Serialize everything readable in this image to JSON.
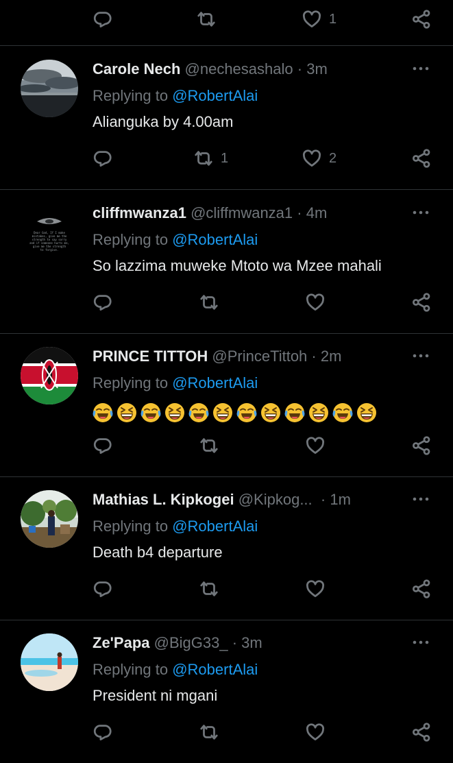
{
  "reply_prefix": "Replying to",
  "colors": {
    "background": "#000000",
    "text": "#e7e9ea",
    "muted": "#71767b",
    "link": "#1d9bf0",
    "divider": "#2f3336"
  },
  "icons": {
    "reply": "comment-icon",
    "retweet": "retweet-icon",
    "like": "heart-icon",
    "share": "share-icon",
    "more": "more-dots-icon"
  },
  "top_actions": {
    "reply_count": "",
    "retweet_count": "",
    "like_count": "1"
  },
  "tweets": [
    {
      "name": "Carole Nech",
      "handle": "@nechesashalo",
      "time": "3m",
      "replying_to": "@RobertAlai",
      "text": "Alianguka by 4.00am",
      "reply_count": "",
      "retweet_count": "1",
      "like_count": "2",
      "avatar": "sky-landscape"
    },
    {
      "name": "cliffmwanza1",
      "handle": "@cliffmwanza1",
      "time": "4m",
      "replying_to": "@RobertAlai",
      "text": "So lazzima muweke Mtoto wa Mzee mahali",
      "reply_count": "",
      "retweet_count": "",
      "like_count": "",
      "avatar": "eye-prayer-text",
      "avatar_text": [
        "Dear God, If I make",
        "mistakes, give me the",
        "strength to say sorry",
        "and if someone hurts me,",
        "give me the strength",
        "to forgive."
      ]
    },
    {
      "name": "PRINCE TITTOH",
      "handle": "@PrinceTittoh",
      "time": "2m",
      "replying_to": "@RobertAlai",
      "text": "",
      "emojis": [
        "tears-of-joy",
        "grinning-squinting",
        "tears-of-joy",
        "grinning-squinting",
        "tears-of-joy",
        "grinning-squinting",
        "tears-of-joy",
        "grinning-squinting",
        "tears-of-joy",
        "grinning-squinting",
        "tears-of-joy",
        "grinning-squinting"
      ],
      "reply_count": "",
      "retweet_count": "",
      "like_count": "",
      "avatar": "kenya-flag"
    },
    {
      "name": "Mathias L. Kipkogei",
      "handle": "@Kipkog...",
      "time": "1m",
      "replying_to": "@RobertAlai",
      "text": "Death b4 departure",
      "reply_count": "",
      "retweet_count": "",
      "like_count": "",
      "avatar": "person-outdoors"
    },
    {
      "name": "Ze'Papa",
      "handle": "@BigG33_",
      "time": "3m",
      "replying_to": "@RobertAlai",
      "text": "President ni mgani",
      "reply_count": "",
      "retweet_count": "",
      "like_count": "",
      "avatar": "beach-person"
    }
  ]
}
